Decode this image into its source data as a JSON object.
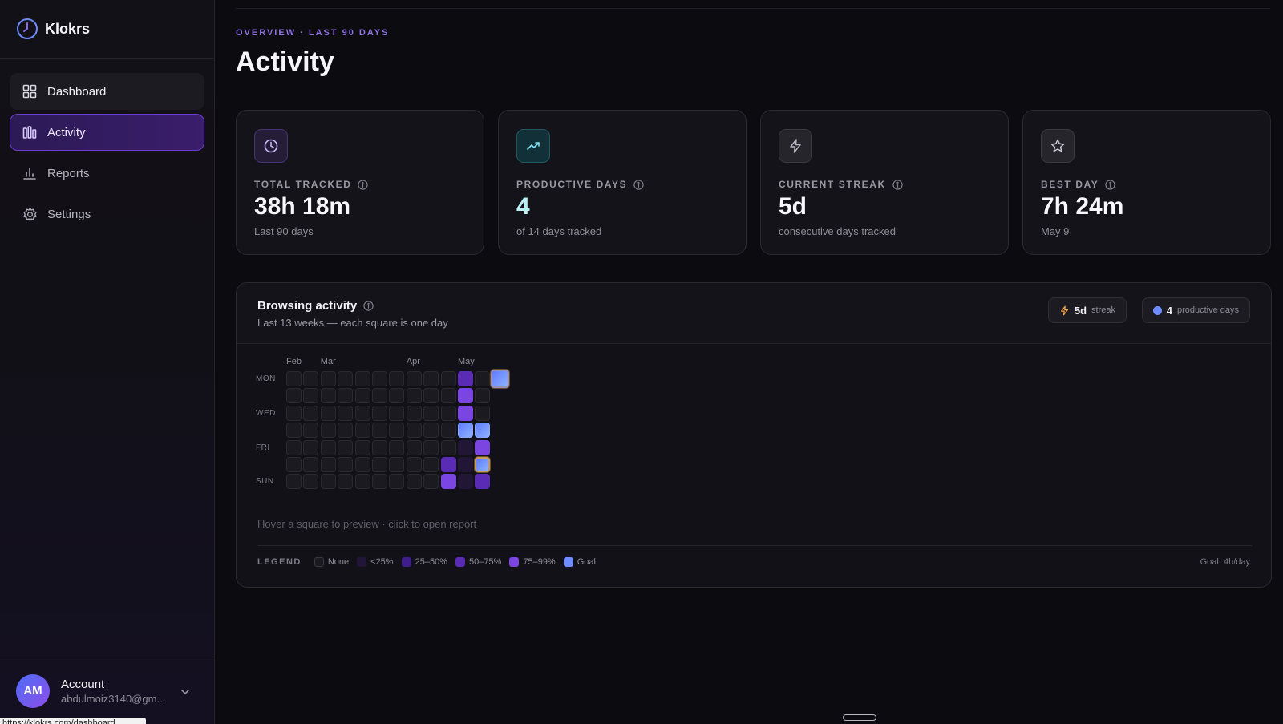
{
  "app": {
    "name": "Klokrs"
  },
  "nav": {
    "items": [
      {
        "label": "Dashboard",
        "icon": "grid-icon"
      },
      {
        "label": "Activity",
        "icon": "bars-icon"
      },
      {
        "label": "Reports",
        "icon": "chart-icon"
      },
      {
        "label": "Settings",
        "icon": "gear-icon"
      }
    ]
  },
  "account": {
    "initials": "AM",
    "title": "Account",
    "email": "abdulmoiz3140@gm..."
  },
  "status_url": "https://klokrs.com/dashboard",
  "header": {
    "eyebrow": "OVERVIEW · LAST 90 DAYS",
    "title": "Activity"
  },
  "stats": [
    {
      "label": "TOTAL TRACKED",
      "value": "38h 18m",
      "sub": "Last 90 days",
      "icon": "clock-icon"
    },
    {
      "label": "PRODUCTIVE DAYS",
      "value": "4",
      "sub": "of 14 days tracked",
      "icon": "trending-up-icon"
    },
    {
      "label": "CURRENT STREAK",
      "value": "5d",
      "sub": "consecutive days tracked",
      "icon": "lightning-icon"
    },
    {
      "label": "BEST DAY",
      "value": "7h 24m",
      "sub": "May 9",
      "icon": "star-icon"
    }
  ],
  "panel": {
    "title": "Browsing activity",
    "subtitle": "Last 13 weeks — each square is one day",
    "streak_pill": {
      "value": "5d",
      "label": "streak"
    },
    "days_pill": {
      "value": "4",
      "label": "productive days"
    },
    "hint": "Hover a square to preview · click to open report",
    "goal": "Goal: 4h/day"
  },
  "heatmap": {
    "months": [
      "Feb",
      "Mar",
      "Apr",
      "May"
    ],
    "month_col": [
      0,
      2,
      7,
      10
    ],
    "day_labels": [
      "MON",
      "WED",
      "FRI",
      "SUN"
    ],
    "day_label_rows": [
      0,
      2,
      4,
      6
    ],
    "weeks": 13,
    "active": [
      {
        "week": 10,
        "day": 0,
        "level": 3
      },
      {
        "week": 10,
        "day": 1,
        "level": 4
      },
      {
        "week": 10,
        "day": 2,
        "level": 4
      },
      {
        "week": 10,
        "day": 3,
        "level": 5
      },
      {
        "week": 10,
        "day": 4,
        "level": 1
      },
      {
        "week": 10,
        "day": 5,
        "level": 1
      },
      {
        "week": 10,
        "day": 6,
        "level": 1
      },
      {
        "week": 9,
        "day": 5,
        "level": 3
      },
      {
        "week": 9,
        "day": 6,
        "level": 4
      },
      {
        "week": 11,
        "day": 3,
        "level": 5
      },
      {
        "week": 11,
        "day": 4,
        "level": 4
      },
      {
        "week": 11,
        "day": 5,
        "level": 5
      },
      {
        "week": 11,
        "day": 6,
        "level": 3
      },
      {
        "week": 12,
        "day": 0,
        "level": 5
      }
    ],
    "highlighted": [
      {
        "week": 12,
        "day": 0
      },
      {
        "week": 11,
        "day": 5
      }
    ],
    "level_colors": [
      "#1b1a21",
      "#221637",
      "#3d1e8a",
      "#5a2bb5",
      "#7a45e0",
      "#6f8dff"
    ]
  },
  "legend": {
    "title": "LEGEND",
    "items": [
      {
        "label": "None",
        "color": "#1b1a21"
      },
      {
        "label": "<25%",
        "color": "#221637"
      },
      {
        "label": "25–50%",
        "color": "#3d1e8a"
      },
      {
        "label": "50–75%",
        "color": "#5a2bb5"
      },
      {
        "label": "75–99%",
        "color": "#7a45e0"
      },
      {
        "label": "Goal",
        "color": "#6f8dff"
      }
    ]
  }
}
